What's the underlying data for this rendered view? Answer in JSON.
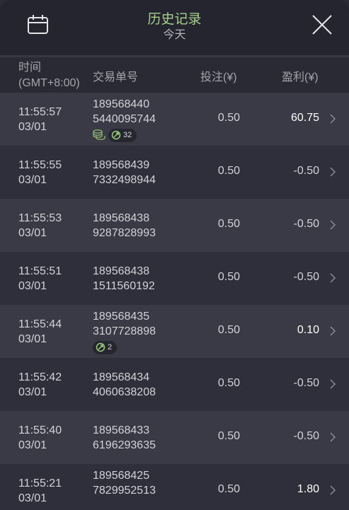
{
  "header": {
    "title": "历史记录",
    "subtitle": "今天",
    "calendar_icon": "calendar-icon",
    "close_icon": "close-icon"
  },
  "columns": {
    "time": "时间",
    "timezone": "(GMT+8:00)",
    "order": "交易单号",
    "bet": "投注(¥)",
    "profit": "盈利(¥)"
  },
  "rows": [
    {
      "time": "11:55:57",
      "date": "03/01",
      "order_1": "189568440",
      "order_2": "5440095744",
      "bet": "0.50",
      "profit": "60.75",
      "win": true,
      "coins_icon": true,
      "spins": "32"
    },
    {
      "time": "11:55:55",
      "date": "03/01",
      "order_1": "189568439",
      "order_2": "7332498944",
      "bet": "0.50",
      "profit": "-0.50",
      "win": false
    },
    {
      "time": "11:55:53",
      "date": "03/01",
      "order_1": "189568438",
      "order_2": "9287828993",
      "bet": "0.50",
      "profit": "-0.50",
      "win": false
    },
    {
      "time": "11:55:51",
      "date": "03/01",
      "order_1": "189568438",
      "order_2": "1511560192",
      "bet": "0.50",
      "profit": "-0.50",
      "win": false
    },
    {
      "time": "11:55:44",
      "date": "03/01",
      "order_1": "189568435",
      "order_2": "3107728898",
      "bet": "0.50",
      "profit": "0.10",
      "win": true,
      "spins": "2"
    },
    {
      "time": "11:55:42",
      "date": "03/01",
      "order_1": "189568434",
      "order_2": "4060638208",
      "bet": "0.50",
      "profit": "-0.50",
      "win": false
    },
    {
      "time": "11:55:40",
      "date": "03/01",
      "order_1": "189568433",
      "order_2": "6196293635",
      "bet": "0.50",
      "profit": "-0.50",
      "win": false
    },
    {
      "time": "11:55:21",
      "date": "03/01",
      "order_1": "189568425",
      "order_2": "7829952513",
      "bet": "0.50",
      "profit": "1.80",
      "win": true
    }
  ]
}
